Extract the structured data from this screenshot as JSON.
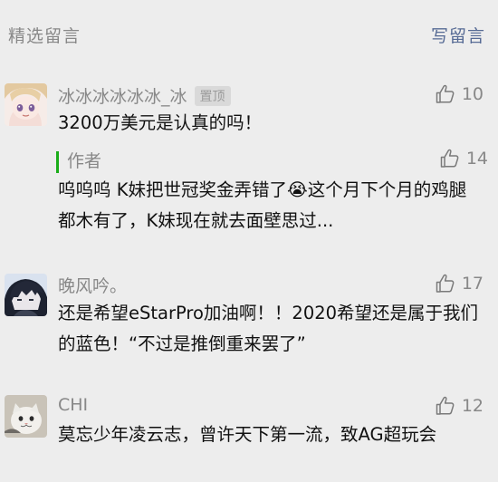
{
  "header": {
    "title": "精选留言",
    "write": "写留言"
  },
  "comments": [
    {
      "nickname": "冰冰冰冰冰冰_冰",
      "pinned": "置顶",
      "likes": "10",
      "text": "3200万美元是认真的吗！",
      "reply": {
        "label": "作者",
        "likes": "14",
        "text": "呜呜呜 K妹把世冠奖金弄错了😭这个月下个月的鸡腿都木有了，K妹现在就去面壁思过..."
      }
    },
    {
      "nickname": "晚风吟。",
      "likes": "17",
      "text": "还是希望eStarPro加油啊！！2020希望还是属于我们的蓝色！“不过是推倒重来罢了”"
    },
    {
      "nickname": "CHI",
      "likes": "12",
      "text": "莫忘少年凌云志，曾许天下第一流，致AG超玩会"
    }
  ],
  "icons": {
    "like": "thumbs-up-icon"
  },
  "colors": {
    "link": "#576b95",
    "author_bar": "#1aad19",
    "muted": "#888888"
  }
}
